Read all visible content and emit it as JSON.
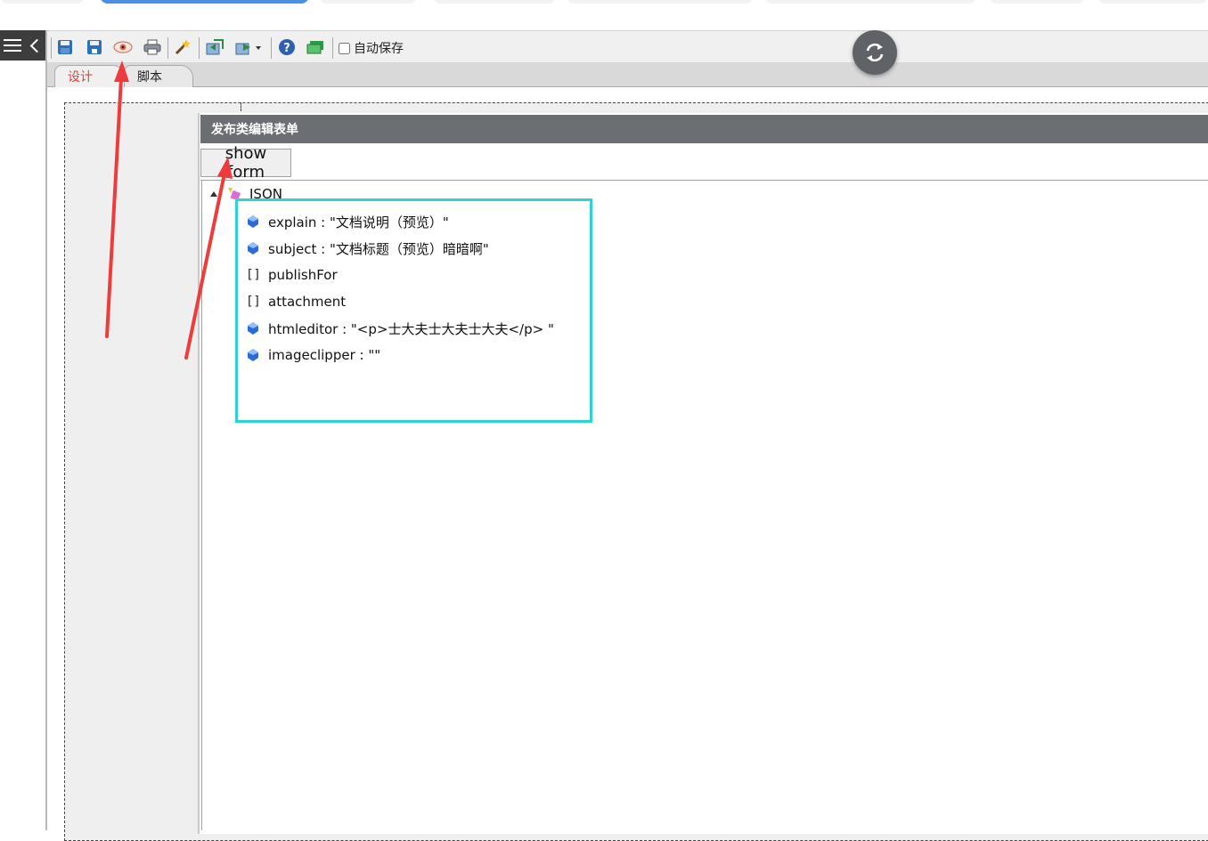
{
  "toolbar": {
    "autosave_label": "自动保存",
    "icons": [
      "save-icon",
      "save-as-icon",
      "preview-eye-icon",
      "print-icon",
      "wizard-wand-icon",
      "import-icon",
      "export-icon",
      "help-icon",
      "form-layer-icon"
    ]
  },
  "tabs": [
    {
      "label": "设计",
      "active": true
    },
    {
      "label": "脚本",
      "active": false
    }
  ],
  "form": {
    "title": "发布类编辑表单",
    "show_button_label": "show form"
  },
  "tree": {
    "root_label": "JSON",
    "nodes": [
      {
        "text": "explain : \"文档说明（预览）\"",
        "type": "value"
      },
      {
        "text": "subject : \"文档标题（预览）暗暗啊\"",
        "type": "value"
      },
      {
        "text": "publishFor",
        "type": "array"
      },
      {
        "text": "attachment",
        "type": "array"
      },
      {
        "text": "htmleditor : \"<p>士大夫士大夫士大夫</p> \"",
        "type": "value"
      },
      {
        "text": "imageclipper : \"\"",
        "type": "value"
      }
    ]
  },
  "colors": {
    "highlight_border": "#2fd3d3",
    "annotation_arrow": "#ee3b3b",
    "active_tab_text": "#e0413e",
    "title_bar": "#6b6e72"
  }
}
